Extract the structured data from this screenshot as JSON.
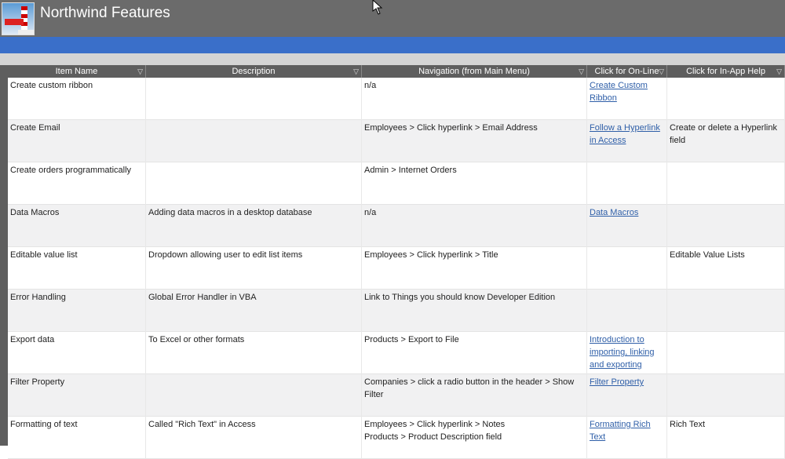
{
  "app": {
    "title": "Northwind Features"
  },
  "columns": [
    "Item Name",
    "Description",
    "Navigation (from Main Menu)",
    "Click for On-Line",
    "Click for In-App Help"
  ],
  "rows": [
    {
      "item": "Create custom ribbon",
      "description": "",
      "navigation": "n/a",
      "online": "Create Custom Ribbon",
      "help": ""
    },
    {
      "item": "Create Email",
      "description": "",
      "navigation": "Employees > Click hyperlink > Email  Address",
      "online": "Follow a Hyperlink in Access",
      "help": "Create or delete a Hyperlink field"
    },
    {
      "item": "Create orders programmatically",
      "description": "",
      "navigation": "Admin > Internet Orders",
      "online": "",
      "help": ""
    },
    {
      "item": "Data Macros",
      "description": "Adding data macros in a desktop database",
      "navigation": "n/a",
      "online": "Data Macros",
      "help": ""
    },
    {
      "item": "Editable value list",
      "description": "Dropdown allowing user to edit list items",
      "navigation": "Employees > Click hyperlink > Title",
      "online": "",
      "help": "Editable Value Lists"
    },
    {
      "item": "Error Handling",
      "description": "Global Error Handler in VBA",
      "navigation": "Link to Things you should know Developer Edition",
      "online": "",
      "help": ""
    },
    {
      "item": "Export data",
      "description": "To Excel or other formats",
      "navigation": "Products > Export to File",
      "online": "Introduction to importing, linking and exporting",
      "help": ""
    },
    {
      "item": "Filter Property",
      "description": "",
      "navigation": "Companies > click a radio button in the header > Show Filter",
      "online": "Filter Property",
      "help": ""
    },
    {
      "item": "Formatting of text",
      "description": "Called \"Rich Text\" in Access",
      "navigation": "Employees > Click hyperlink > Notes\nProducts > Product Description field",
      "online": "Formatting Rich Text",
      "help": "Rich Text"
    }
  ]
}
